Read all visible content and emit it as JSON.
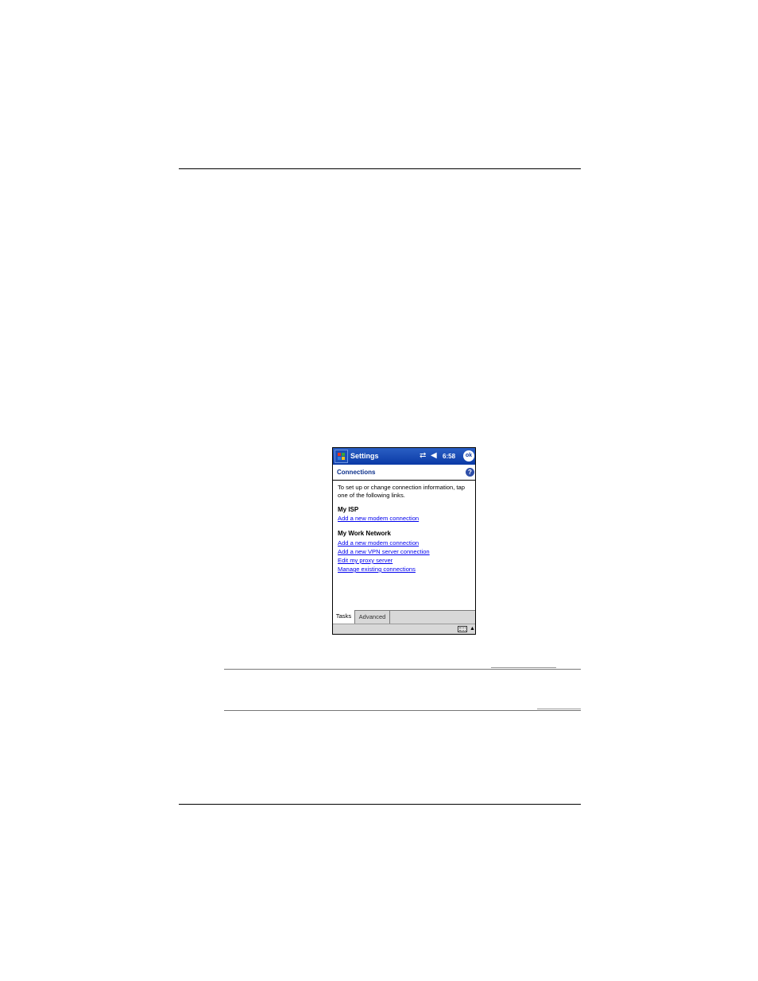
{
  "window": {
    "app_title": "Settings",
    "clock": "6:58",
    "ok_label": "ok",
    "sync_icon": "⇄",
    "volume_icon": "◀",
    "help_icon": "?"
  },
  "page": {
    "title": "Connections",
    "intro": "To set up or change connection information, tap one of the following links."
  },
  "sections": [
    {
      "heading": "My ISP",
      "links": [
        "Add a new modem connection"
      ]
    },
    {
      "heading": "My Work Network",
      "links": [
        "Add a new modem connection",
        "Add a new VPN server connection",
        "Edit my proxy server",
        "Manage existing connections"
      ]
    }
  ],
  "tabs": [
    "Tasks",
    "Advanced"
  ],
  "active_tab": "Tasks",
  "colors": {
    "titlebar": "#0b3aa6",
    "link": "#0000ee"
  }
}
